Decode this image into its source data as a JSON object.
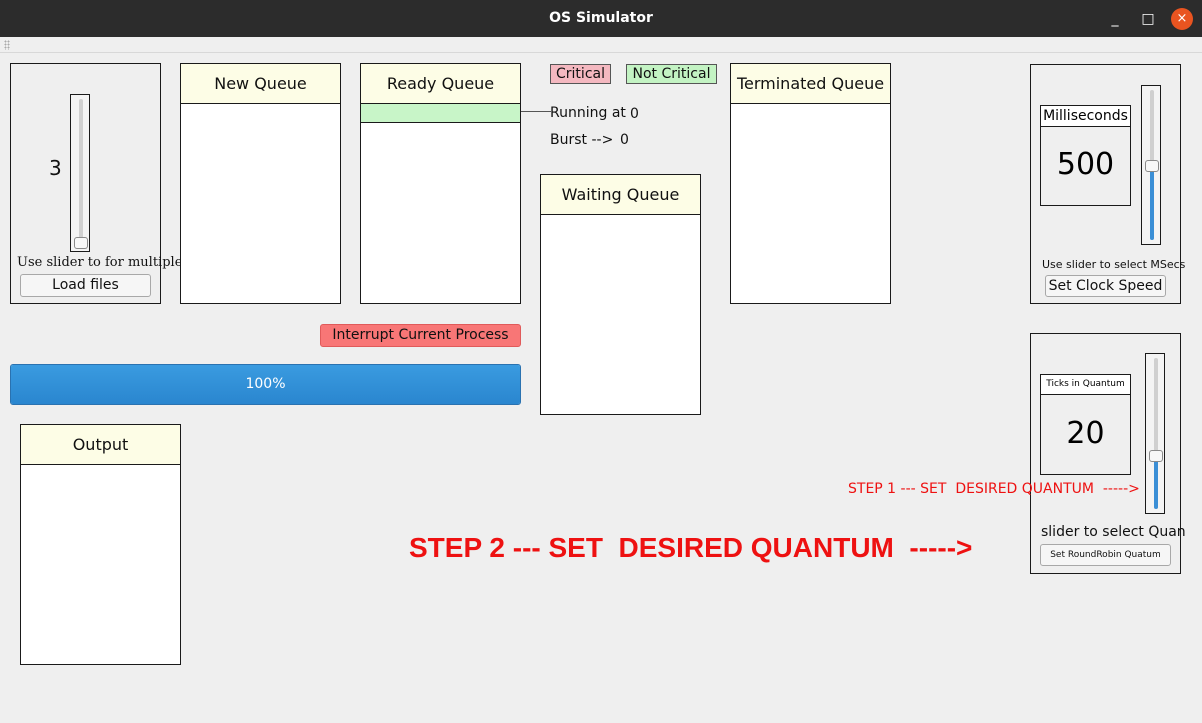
{
  "window": {
    "title": "OS Simulator",
    "minimize": "_",
    "maximize": "□",
    "close": "×"
  },
  "loader": {
    "count": "3",
    "slider_caption": "Use slider to for multiples",
    "load_button": "Load files",
    "slider_level": 0.0
  },
  "queues": {
    "new": "New Queue",
    "ready": "Ready Queue",
    "terminated": "Terminated Queue",
    "waiting": "Waiting Queue",
    "output": "Output"
  },
  "legend": {
    "critical": "Critical",
    "not_critical": "Not Critical",
    "critical_color": "#f4b8c0",
    "not_critical_color": "#c3f3c3"
  },
  "running": {
    "label": "Running at",
    "value": "0",
    "burst_label": "Burst -->",
    "burst_value": "0"
  },
  "interrupt_button": "Interrupt Current Process",
  "progress": {
    "label": "100%",
    "value": 1.0
  },
  "clock": {
    "header": "Milliseconds",
    "value": "500",
    "caption": "Use slider to select MSecs",
    "button": "Set Clock Speed",
    "slider_level": 0.5
  },
  "quantum": {
    "header": "Ticks in Quantum",
    "value": "20",
    "caption": "slider to select Quan",
    "button": "Set RoundRobin Quatum",
    "slider_level": 0.35
  },
  "annotations": {
    "step1": "STEP 1 --- SET  DESIRED QUANTUM  ----->",
    "step2": "STEP 2 --- SET  DESIRED QUANTUM  ----->"
  }
}
